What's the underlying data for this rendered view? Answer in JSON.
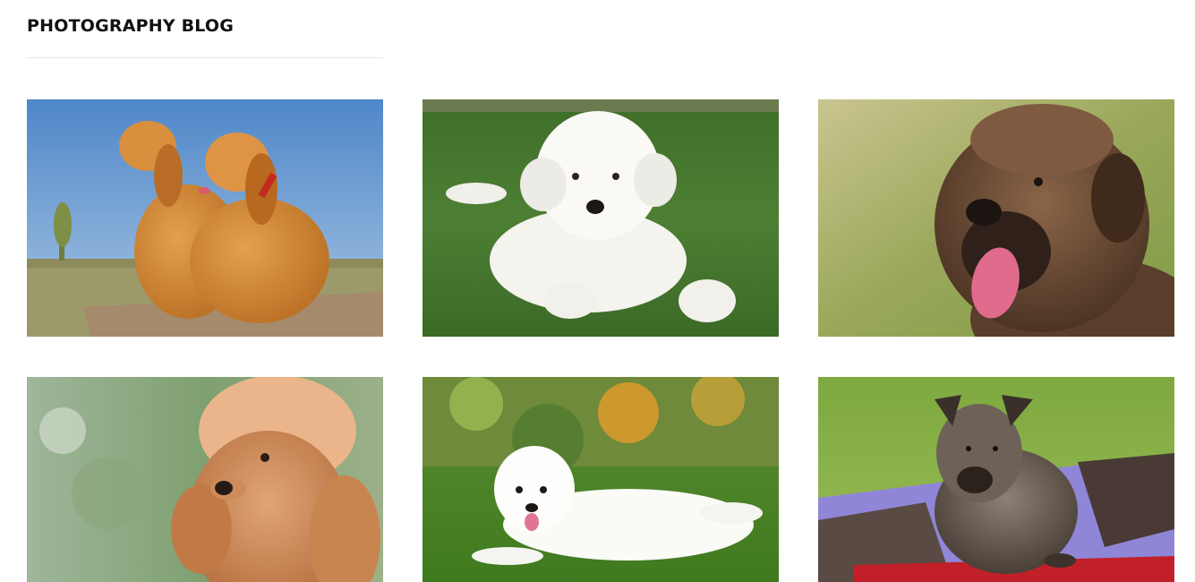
{
  "blog": {
    "title": "PHOTOGRAPHY BLOG"
  },
  "photos": [
    {
      "subject": "two-cocker-spaniels"
    },
    {
      "subject": "white-fluffy-puppy-on-grass"
    },
    {
      "subject": "curly-brown-water-dog"
    },
    {
      "subject": "apricot-toy-poodle"
    },
    {
      "subject": "samoyed-lying-on-grass"
    },
    {
      "subject": "puppy-on-blanket"
    }
  ]
}
